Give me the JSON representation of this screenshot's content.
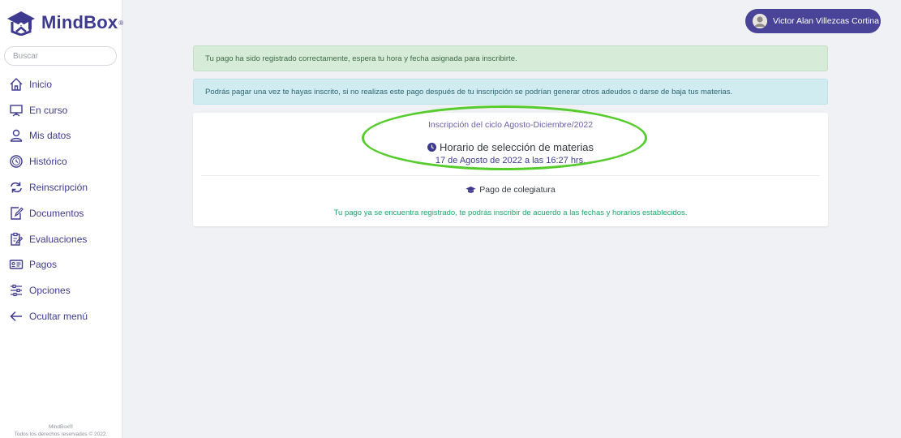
{
  "app": {
    "logo_text": "MindBox",
    "logo_reg": "®"
  },
  "colors": {
    "brand": "#3d3a8f",
    "user_button": "#4a4498",
    "success_text": "#18a86a",
    "highlight": "#55cc2c"
  },
  "search": {
    "placeholder": "Buscar"
  },
  "sidebar": {
    "items": [
      {
        "label": "Inicio",
        "icon": "home-icon"
      },
      {
        "label": "En curso",
        "icon": "presentation-board-icon"
      },
      {
        "label": "Mis datos",
        "icon": "user-icon"
      },
      {
        "label": "Histórico",
        "icon": "clock-history-icon"
      },
      {
        "label": "Reinscripción",
        "icon": "refresh-arrows-icon"
      },
      {
        "label": "Documentos",
        "icon": "document-edit-icon"
      },
      {
        "label": "Evaluaciones",
        "icon": "clipboard-edit-icon"
      },
      {
        "label": "Pagos",
        "icon": "id-card-icon"
      },
      {
        "label": "Opciones",
        "icon": "sliders-icon"
      },
      {
        "label": "Ocultar menú",
        "icon": "arrow-left-icon"
      }
    ]
  },
  "footer": {
    "line1": "MindBox®",
    "line2": "Todos los derechos reservados © 2022."
  },
  "user": {
    "name": "Victor Alan Villezcas Cortina"
  },
  "alerts": {
    "success": "Tu pago ha sido registrado correctamente, espera tu hora y fecha asignada para inscribirte.",
    "info": "Podrás pagar una vez te hayas inscrito, si no realizas este pago después de tu inscripción se podrían generar otros adeudos o darse de baja tus materias."
  },
  "card": {
    "cycle": "Inscripción del ciclo Agosto-Diciembre/2022",
    "schedule_title": "Horario de selección de materias",
    "schedule_date": "17 de Agosto de 2022 a las 16:27 hrs.",
    "tuition_title": "Pago de colegiatura",
    "paid_message": "Tu pago ya se encuentra registrado, te podrás inscribir de acuerdo a las fechas y horarios establecidos."
  }
}
